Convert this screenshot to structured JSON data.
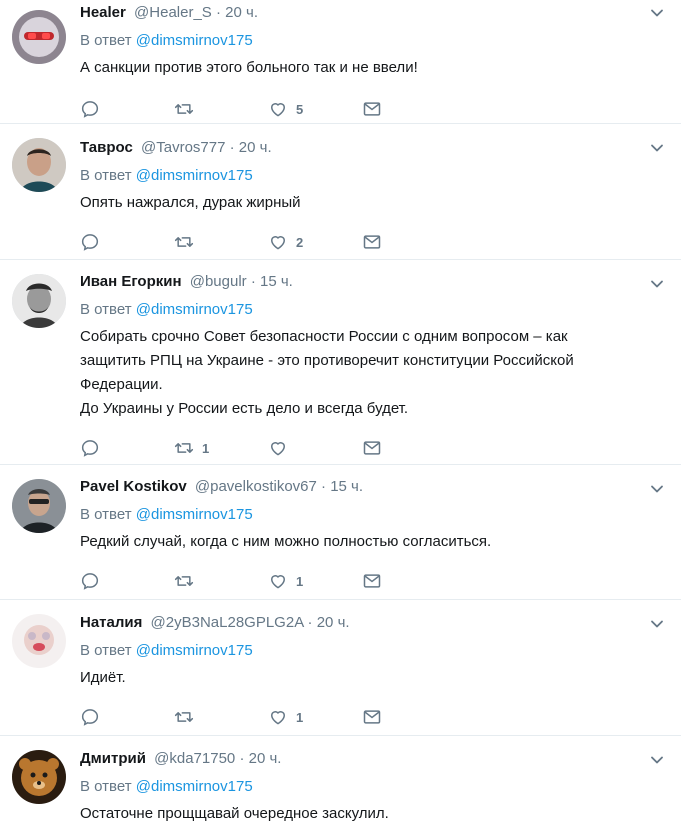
{
  "tweets": [
    {
      "fullname": "Healer",
      "username": "@Healer_S",
      "time": "20 ч.",
      "reply_prefix": "В ответ",
      "reply_to": "@dimsmirnov175",
      "text": "А санкции против этого больного так и не ввели!",
      "reply_count": "",
      "retweet_count": "",
      "like_count": "5",
      "avatar_color": "#7a6f7a"
    },
    {
      "fullname": "Таврос",
      "username": "@Tavros777",
      "time": "20 ч.",
      "reply_prefix": "В ответ",
      "reply_to": "@dimsmirnov175",
      "text": "Опять нажрался, дурак жирный",
      "reply_count": "",
      "retweet_count": "",
      "like_count": "2",
      "avatar_color": "#5a4a3f"
    },
    {
      "fullname": "Иван Егоркин",
      "username": "@bugulr",
      "time": "15 ч.",
      "reply_prefix": "В ответ",
      "reply_to": "@dimsmirnov175",
      "text": "Собирать срочно Совет безопасности России с одним вопросом – как\nзащитить РПЦ на Украине - это противоречит конституции Российской\nФедерации.\nДо Украины у России есть дело и всегда будет.",
      "reply_count": "",
      "retweet_count": "1",
      "like_count": "",
      "avatar_color": "#3c3c3c"
    },
    {
      "fullname": "Pavel Kostikov",
      "username": "@pavelkostikov67",
      "time": "15 ч.",
      "reply_prefix": "В ответ",
      "reply_to": "@dimsmirnov175",
      "text": "Редкий случай, когда с ним можно полностью согласиться.",
      "reply_count": "",
      "retweet_count": "",
      "like_count": "1",
      "avatar_color": "#6b6e73"
    },
    {
      "fullname": "Наталия",
      "username": "@2yB3NaL28GPLG2A",
      "time": "20 ч.",
      "reply_prefix": "В ответ",
      "reply_to": "@dimsmirnov175",
      "text": "Идиёт.",
      "reply_count": "",
      "retweet_count": "",
      "like_count": "1",
      "avatar_color": "#e8d8d8"
    },
    {
      "fullname": "Дмитрий",
      "username": "@kda71750",
      "time": "20 ч.",
      "reply_prefix": "В ответ",
      "reply_to": "@dimsmirnov175",
      "text": "Остаточне прощщавай очередное заскулил.",
      "reply_count": "",
      "retweet_count": "",
      "like_count": "",
      "avatar_color": "#8a5a2a"
    }
  ],
  "colors": {
    "link": "#1b95e0",
    "muted": "#657786",
    "text": "#14171a",
    "divider": "#e6ecf0"
  },
  "icons": [
    "reply-icon",
    "retweet-icon",
    "like-icon",
    "direct-message-icon",
    "chevron-down-icon"
  ]
}
